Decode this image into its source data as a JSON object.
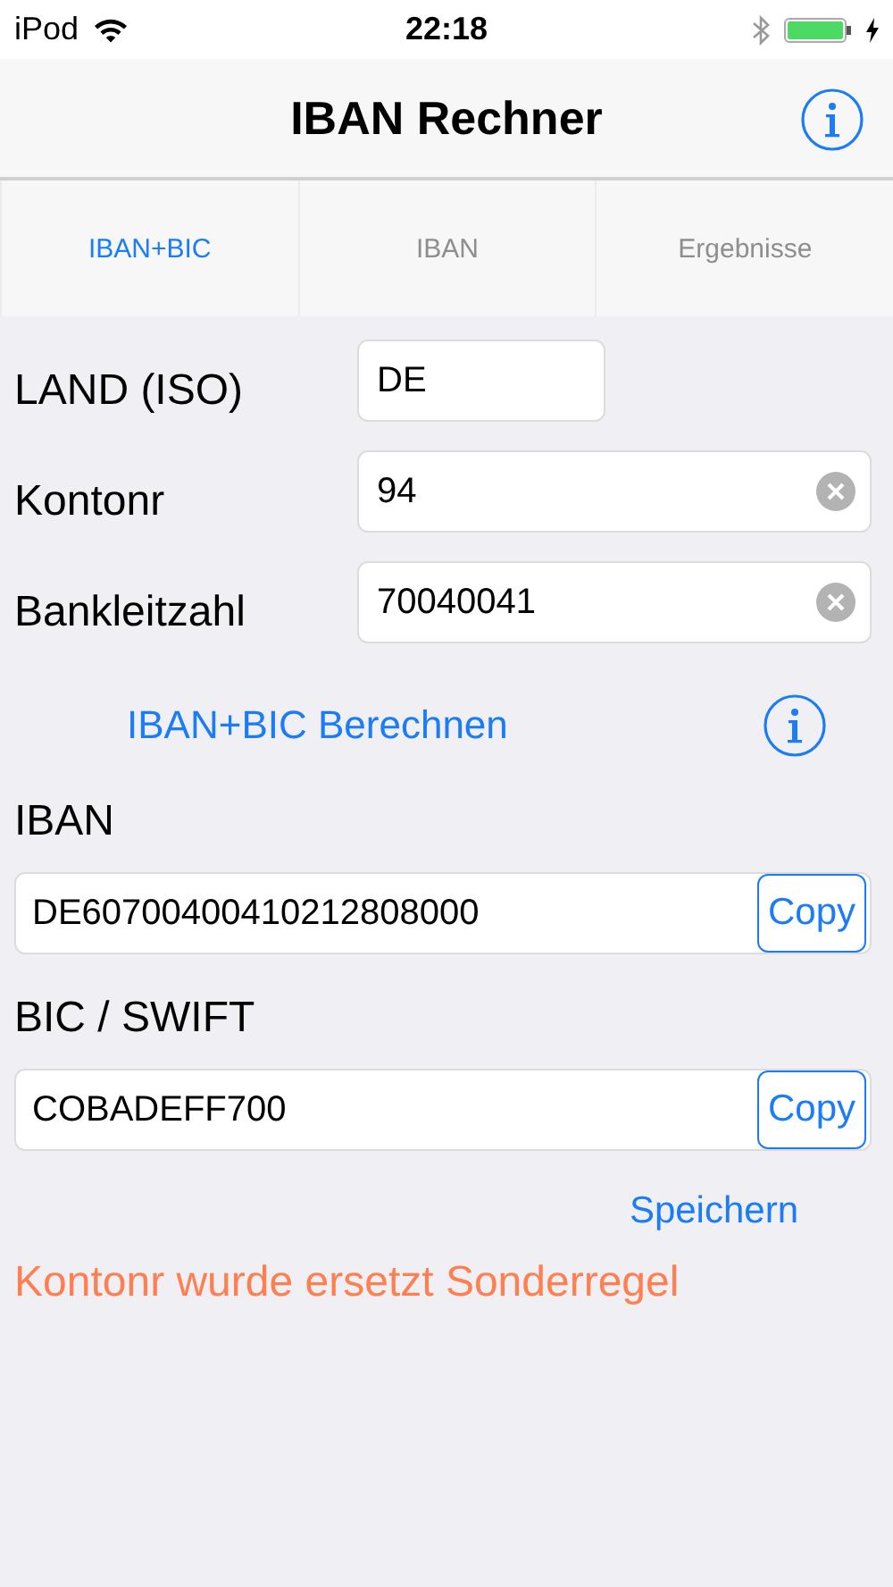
{
  "status_bar": {
    "carrier": "iPod",
    "time": "22:18"
  },
  "nav_bar": {
    "title": "IBAN Rechner"
  },
  "tabs": [
    {
      "label": "IBAN+BIC",
      "selected": true
    },
    {
      "label": "IBAN",
      "selected": false
    },
    {
      "label": "Ergebnisse",
      "selected": false
    }
  ],
  "form": [
    {
      "label": "LAND (ISO)",
      "value": "DE",
      "clear_button": false
    },
    {
      "label": "Kontonr",
      "value": "94",
      "clear_button": true
    },
    {
      "label": "Bankleitzahl",
      "value": "70040041",
      "clear_button": true
    }
  ],
  "calculate_button": "IBAN+BIC Berechnen",
  "results": [
    {
      "label": "IBAN",
      "value": "DE60700400410212808000",
      "button": "Copy"
    },
    {
      "label": "BIC / SWIFT",
      "value": "COBADEFF700",
      "button": "Copy"
    }
  ],
  "save_button": "Speichern",
  "message": "Kontonr wurde ersetzt Sonderregel"
}
